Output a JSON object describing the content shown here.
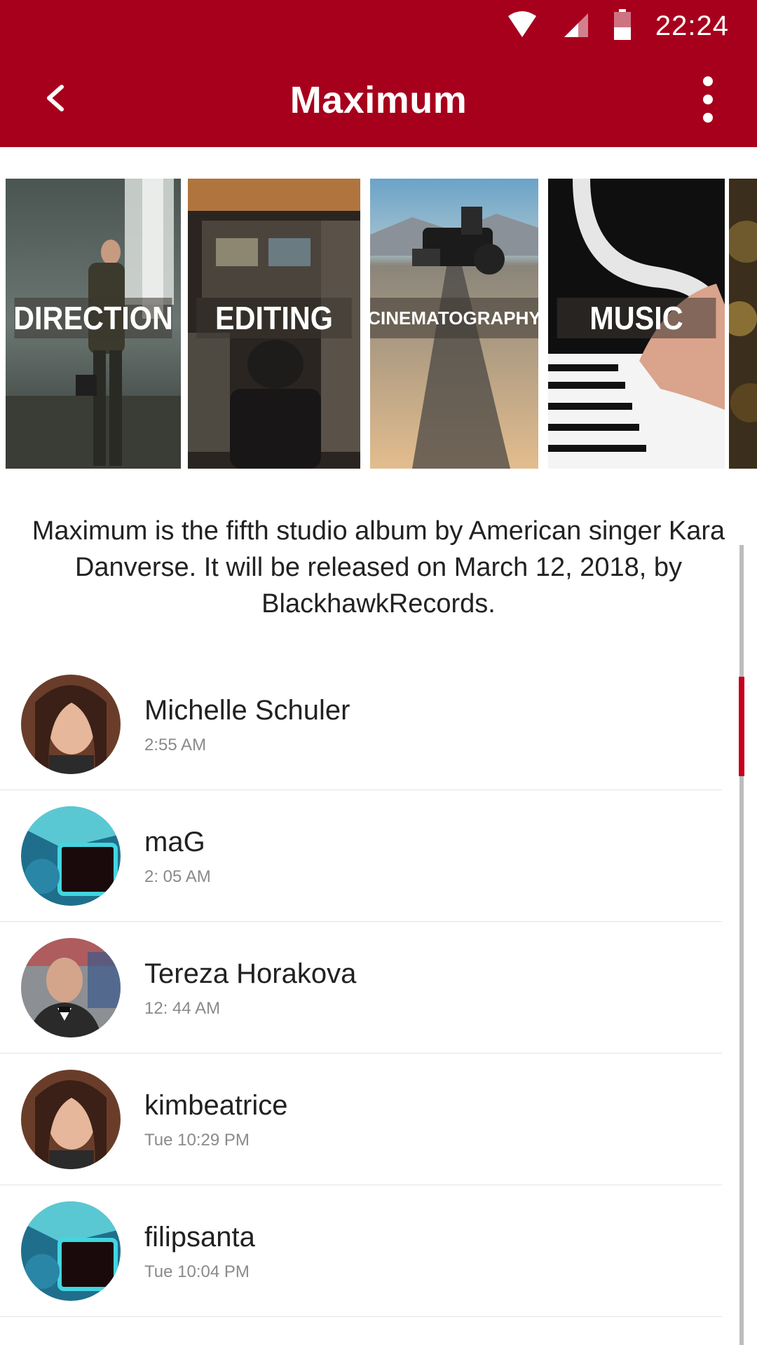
{
  "status_bar": {
    "time": "22:24"
  },
  "app_bar": {
    "title": "Maximum"
  },
  "categories": [
    {
      "label": "DIRECTION"
    },
    {
      "label": "EDITING"
    },
    {
      "label": "CINEMATOGRAPHY"
    },
    {
      "label": "MUSIC"
    }
  ],
  "description": "Maximum is the fifth studio album by American singer Kara Danverse. It will be released on March 12, 2018, by BlackhawkRecords.",
  "list": [
    {
      "name": "Michelle Schuler",
      "time": "2:55 AM"
    },
    {
      "name": "maG",
      "time": "2: 05 AM"
    },
    {
      "name": "Tereza Horakova",
      "time": "12: 44 AM"
    },
    {
      "name": "kimbeatrice",
      "time": "Tue 10:29 PM"
    },
    {
      "name": "filipsanta",
      "time": "Tue 10:04 PM"
    }
  ],
  "colors": {
    "primary": "#a7001c",
    "accent": "#c4001d"
  }
}
